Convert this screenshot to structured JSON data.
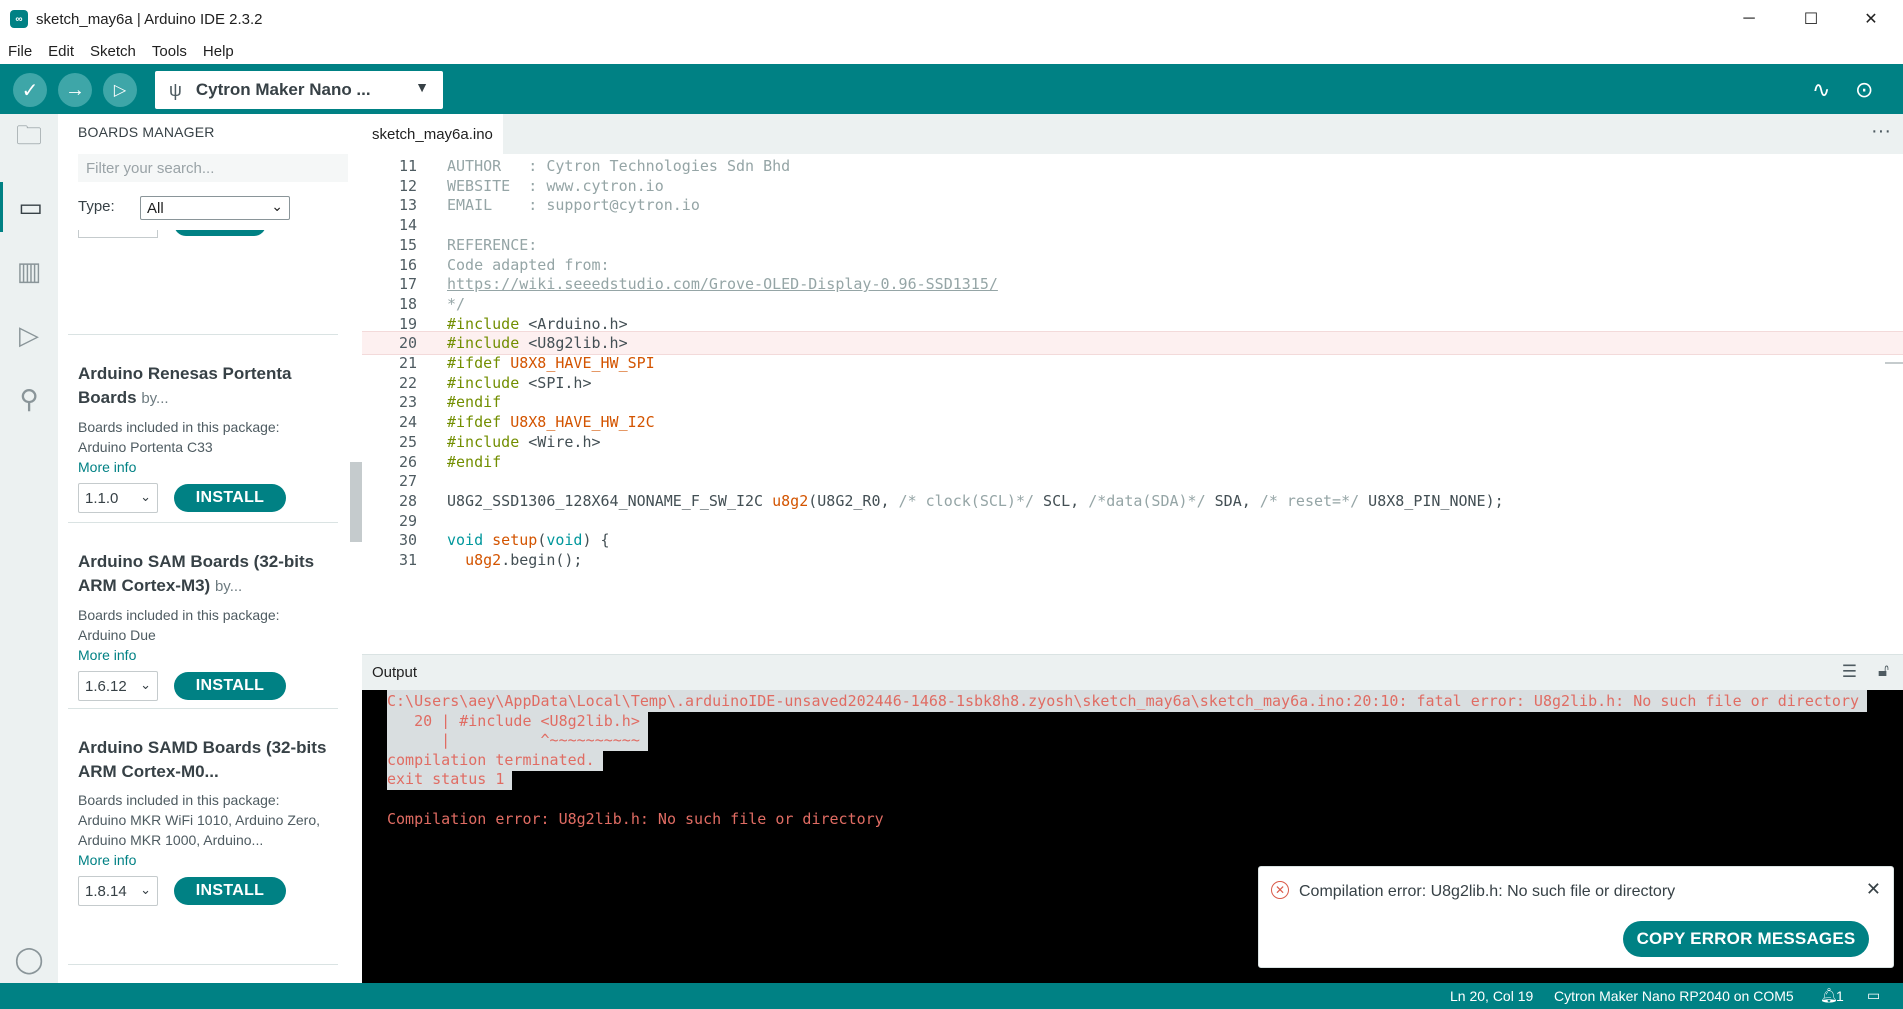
{
  "window": {
    "title": "sketch_may6a | Arduino IDE 2.3.2",
    "minimize": "─",
    "maximize": "☐",
    "close": "✕"
  },
  "menu": [
    "File",
    "Edit",
    "Sketch",
    "Tools",
    "Help"
  ],
  "toolbar": {
    "verify_icon": "check-icon",
    "upload_icon": "arrow-right-icon",
    "debug_icon": "debug-icon",
    "board_name": "Cytron Maker Nano ...",
    "serial_plotter_icon": "serial-plotter-icon",
    "serial_monitor_icon": "serial-monitor-icon"
  },
  "activity_bar": [
    "folder-icon",
    "board-icon",
    "library-icon",
    "debug-icon",
    "search-icon",
    "profile-icon"
  ],
  "boards_manager": {
    "title": "BOARDS MANAGER",
    "search_placeholder": "Filter your search...",
    "type_label": "Type:",
    "type_value": "All",
    "items": [
      {
        "name": "Arduino Renesas Portenta Boards",
        "by": "by...",
        "included_label": "Boards included in this package:",
        "included": "Arduino Portenta C33",
        "more_info": "More info",
        "version": "1.1.0",
        "install": "INSTALL"
      },
      {
        "name": "Arduino SAM Boards (32-bits ARM Cortex-M3)",
        "by": "by...",
        "included_label": "Boards included in this package:",
        "included": "Arduino Due",
        "more_info": "More info",
        "version": "1.6.12",
        "install": "INSTALL"
      },
      {
        "name": "Arduino SAMD Boards (32-bits ARM Cortex-M0...",
        "by": "",
        "included_label": "Boards included in this package:",
        "included": "Arduino MKR WiFi 1010, Arduino Zero, Arduino MKR 1000, Arduino...",
        "more_info": "More info",
        "version": "1.8.14",
        "install": "INSTALL"
      }
    ]
  },
  "editor": {
    "tab": "sketch_may6a.ino",
    "more": "···",
    "active_line": 20,
    "lines": [
      {
        "n": "11",
        "segs": [
          [
            "c",
            "AUTHOR   : Cytron Technologies Sdn Bhd"
          ]
        ]
      },
      {
        "n": "12",
        "segs": [
          [
            "c",
            "WEBSITE  : www.cytron.io"
          ]
        ]
      },
      {
        "n": "13",
        "segs": [
          [
            "c",
            "EMAIL    : support@cytron.io"
          ]
        ]
      },
      {
        "n": "14",
        "segs": []
      },
      {
        "n": "15",
        "segs": [
          [
            "c",
            "REFERENCE:"
          ]
        ]
      },
      {
        "n": "16",
        "segs": [
          [
            "c",
            "Code adapted from:"
          ]
        ]
      },
      {
        "n": "17",
        "segs": [
          [
            "u",
            "https://wiki.seeedstudio.com/Grove-OLED-Display-0.96-SSD1315/"
          ]
        ]
      },
      {
        "n": "18",
        "segs": [
          [
            "c",
            "*/"
          ]
        ]
      },
      {
        "n": "19",
        "segs": [
          [
            "p",
            "#include"
          ],
          [
            "t",
            " <Arduino.h>"
          ]
        ]
      },
      {
        "n": "20",
        "segs": [
          [
            "p",
            "#include"
          ],
          [
            "t",
            " <U8g2lib.h>"
          ]
        ]
      },
      {
        "n": "21",
        "segs": [
          [
            "p",
            "#ifdef"
          ],
          [
            "t",
            " "
          ],
          [
            "f",
            "U8X8_HAVE_HW_SPI"
          ]
        ]
      },
      {
        "n": "22",
        "segs": [
          [
            "p",
            "#include"
          ],
          [
            "t",
            " <SPI.h>"
          ]
        ]
      },
      {
        "n": "23",
        "segs": [
          [
            "p",
            "#endif"
          ]
        ]
      },
      {
        "n": "24",
        "segs": [
          [
            "p",
            "#ifdef"
          ],
          [
            "t",
            " "
          ],
          [
            "f",
            "U8X8_HAVE_HW_I2C"
          ]
        ]
      },
      {
        "n": "25",
        "segs": [
          [
            "p",
            "#include"
          ],
          [
            "t",
            " <Wire.h>"
          ]
        ]
      },
      {
        "n": "26",
        "segs": [
          [
            "p",
            "#endif"
          ]
        ]
      },
      {
        "n": "27",
        "segs": []
      },
      {
        "n": "28",
        "segs": [
          [
            "t",
            "U8G2_SSD1306_128X64_NONAME_F_SW_I2C "
          ],
          [
            "f",
            "u8g2"
          ],
          [
            "t",
            "(U8G2_R0, "
          ],
          [
            "c",
            "/* clock(SCL)*/"
          ],
          [
            "t",
            " SCL, "
          ],
          [
            "c",
            "/*data(SDA)*/"
          ],
          [
            "t",
            " SDA, "
          ],
          [
            "c",
            "/* reset=*/"
          ],
          [
            "t",
            " U8X8_PIN_NONE);"
          ]
        ]
      },
      {
        "n": "29",
        "segs": []
      },
      {
        "n": "30",
        "segs": [
          [
            "k",
            "void"
          ],
          [
            "t",
            " "
          ],
          [
            "f",
            "setup"
          ],
          [
            "t",
            "("
          ],
          [
            "k",
            "void"
          ],
          [
            "t",
            ") {"
          ]
        ]
      },
      {
        "n": "31",
        "segs": [
          [
            "t",
            "  "
          ],
          [
            "f",
            "u8g2"
          ],
          [
            "t",
            ".begin();"
          ]
        ]
      }
    ]
  },
  "output": {
    "title": "Output",
    "clear_icon": "clear-output-icon",
    "lock_icon": "lock-icon",
    "lines": [
      {
        "text": "C:\\Users\\aey\\AppData\\Local\\Temp\\.arduinoIDE-unsaved202446-1468-1sbk8h8.zyosh\\sketch_may6a\\sketch_may6a.ino:20:10: fatal error: U8g2lib.h: No such file or directory",
        "sel": true
      },
      {
        "text": "   20 | #include <U8g2lib.h>",
        "sel": true
      },
      {
        "text": "      |          ^~~~~~~~~~~",
        "sel": true
      },
      {
        "text": "compilation terminated.",
        "sel": true
      },
      {
        "text": "exit status 1",
        "sel": true
      },
      {
        "text": "",
        "sel": false
      },
      {
        "text": "Compilation error: U8g2lib.h: No such file or directory",
        "sel": false
      }
    ]
  },
  "notification": {
    "message": "Compilation error: U8g2lib.h: No such file or directory",
    "copy_button": "COPY ERROR MESSAGES",
    "close": "✕"
  },
  "status": {
    "position": "Ln 20, Col 19",
    "board": "Cytron Maker Nano RP2040 on COM5",
    "notification_count": "1"
  },
  "colors": {
    "accent": "#008184",
    "error": "#e06c63"
  }
}
